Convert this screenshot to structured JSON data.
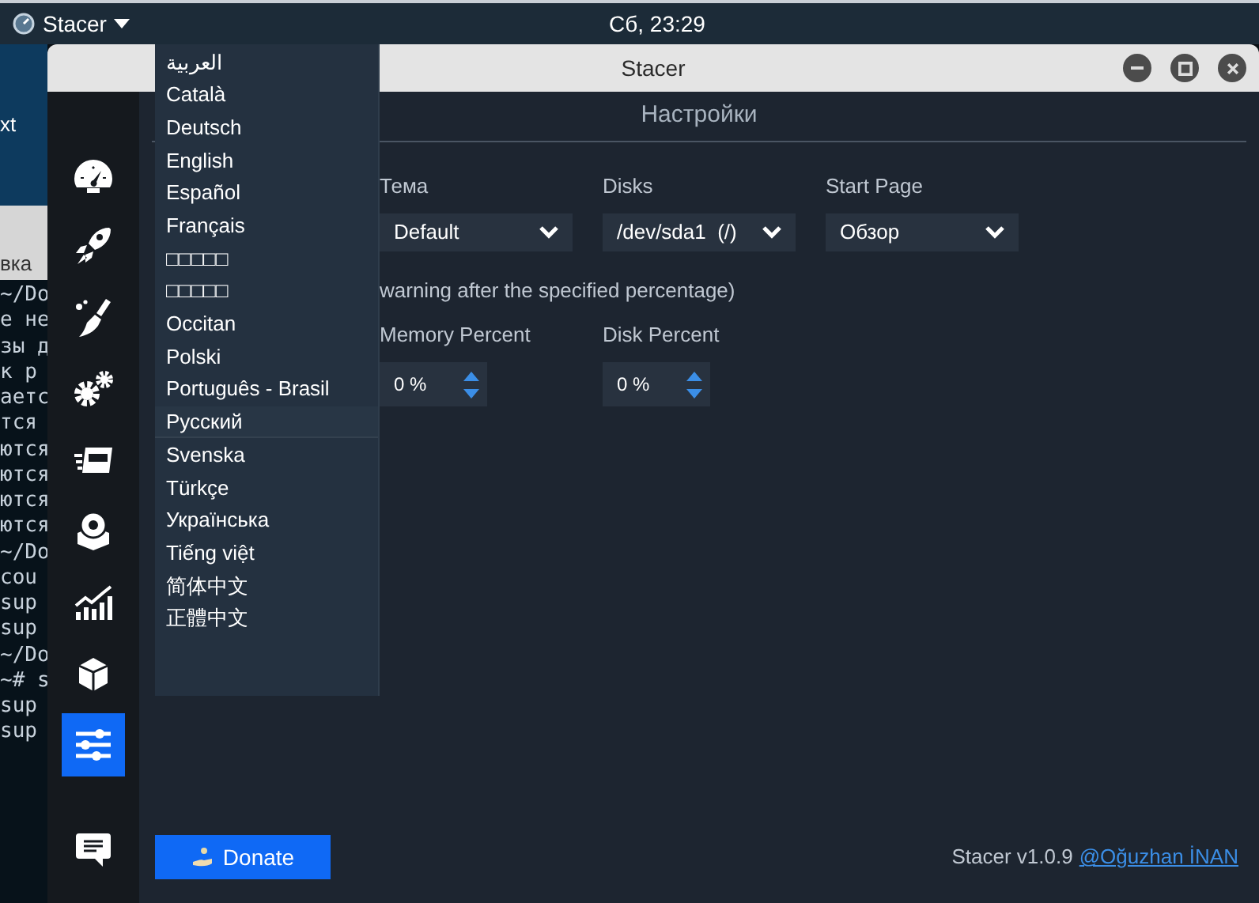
{
  "top_panel": {
    "app_menu": "Stacer",
    "clock": "Сб, 23:29"
  },
  "terminal": {
    "top_text": "xt",
    "tab": "вка",
    "lines": [
      "~/Do",
      "е не",
      "зы д",
      "к р",
      "аетс",
      "тся",
      "ются",
      "ются",
      "ются",
      "ются",
      "~/Do",
      "cou",
      "sup",
      "sup",
      "~/Do",
      "~# s",
      "sup",
      "sup"
    ]
  },
  "window": {
    "title": "Stacer"
  },
  "sidebar": [
    {
      "kind": "dashboard",
      "selected": false
    },
    {
      "kind": "startup",
      "selected": false
    },
    {
      "kind": "cleaner",
      "selected": false
    },
    {
      "kind": "services",
      "selected": false
    },
    {
      "kind": "processes",
      "selected": false
    },
    {
      "kind": "uninstaller",
      "selected": false
    },
    {
      "kind": "resources",
      "selected": false
    },
    {
      "kind": "packages",
      "selected": false
    },
    {
      "kind": "settings",
      "selected": true
    }
  ],
  "feedback_button": {
    "kind": "feedback"
  },
  "page_title": "Настройки",
  "fields": [
    {
      "label": "Тема",
      "value": "Default"
    },
    {
      "label": "Disks",
      "value": "/dev/sda1  (/)"
    },
    {
      "label": "Start Page",
      "value": "Обзор"
    }
  ],
  "warning_note": "warning after the specified percentage)",
  "spinners": [
    {
      "label": "Memory Percent",
      "value": "0 %"
    },
    {
      "label": "Disk Percent",
      "value": "0 %"
    }
  ],
  "language_menu": [
    {
      "label": "العربية",
      "selected": false
    },
    {
      "label": "Català",
      "selected": false
    },
    {
      "label": "Deutsch",
      "selected": false
    },
    {
      "label": "English",
      "selected": false
    },
    {
      "label": "Español",
      "selected": false
    },
    {
      "label": "Français",
      "selected": false
    },
    {
      "label": "□□□□□",
      "selected": false
    },
    {
      "label": "□□□□□",
      "selected": false
    },
    {
      "label": "Occitan",
      "selected": false
    },
    {
      "label": "Polski",
      "selected": false
    },
    {
      "label": "Português - Brasil",
      "selected": false
    },
    {
      "label": "Русский",
      "selected": true
    },
    {
      "label": "Svenska",
      "selected": false
    },
    {
      "label": "Türkçe",
      "selected": false
    },
    {
      "label": "Українська",
      "selected": false
    },
    {
      "label": "Tiếng việt",
      "selected": false
    },
    {
      "label": "简体中文",
      "selected": false
    },
    {
      "label": "正體中文",
      "selected": false
    }
  ],
  "donate_button": "Donate",
  "version": "Stacer v1.0.9",
  "author_link": "@Oğuzhan İNAN"
}
